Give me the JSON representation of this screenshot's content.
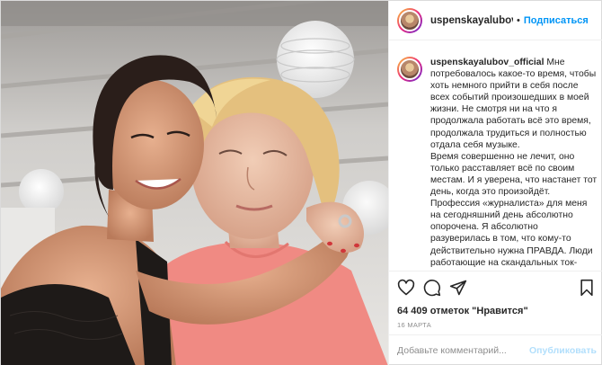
{
  "post": {
    "username": "uspenskayalubov_official",
    "username_short": "uspenskayalubov",
    "follow_label": "Подписаться",
    "separator": "•",
    "caption_paragraphs": [
      "Мне потребовалось какое-то время, чтобы хоть немного прийти в себя после всех событий произошедших в моей жизни. Не смотря ни на что я продолжала работать всё это время, продолжала трудиться и полностью отдала себя музыке.",
      "Время совершенно не лечит, оно только расставляет всё по своим местам. И я уверена, что настанет тот день, когда это произойдёт. Профессия «журналиста» для меня на сегодняшний день абсолютно опорочена. Я абсолютно разуверилась в том, что кому-то действительно нужна ПРАВДА. Люди работающие на скандальных ток-"
    ],
    "likes_text": "64 409 отметок \"Нравится\"",
    "date_text": "16 МАРТА",
    "comment_placeholder": "Добавьте комментарий...",
    "post_button_label": "Опубликовать"
  },
  "icons": {
    "like": "heart-icon",
    "comment": "comment-icon",
    "share": "share-icon",
    "save": "bookmark-icon"
  },
  "colors": {
    "link_blue": "#0095f6",
    "post_disabled": "#b2dffc",
    "muted": "#8e8e8e",
    "text": "#262626"
  }
}
